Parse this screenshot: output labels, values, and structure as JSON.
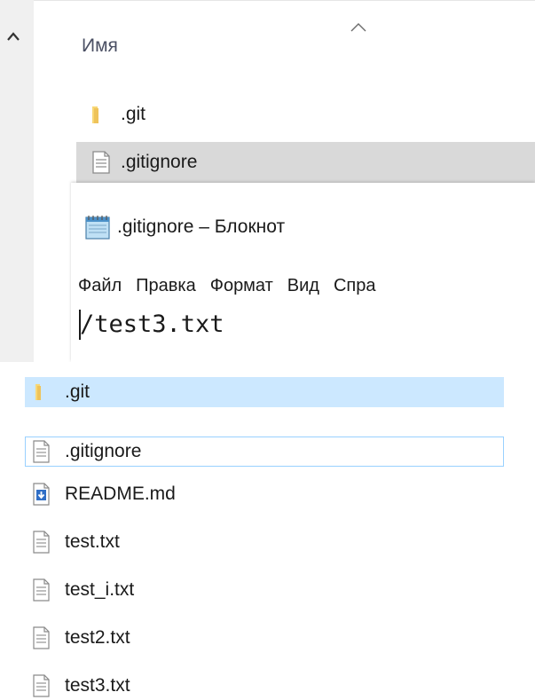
{
  "top_explorer": {
    "column_header": "Имя",
    "items": [
      {
        "name": ".git",
        "icon": "folder-icon"
      },
      {
        "name": ".gitignore",
        "icon": "text-file-icon",
        "selected": true
      }
    ]
  },
  "notepad": {
    "title": ".gitignore – Блокнот",
    "menu": [
      "Файл",
      "Правка",
      "Формат",
      "Вид",
      "Спра"
    ],
    "content": "/test3.txt"
  },
  "bottom_explorer": {
    "items": [
      {
        "name": ".git",
        "icon": "folder-icon"
      },
      {
        "name": ".gitignore",
        "icon": "text-file-icon"
      },
      {
        "name": "README.md",
        "icon": "download-file-icon"
      },
      {
        "name": "test.txt",
        "icon": "text-file-icon"
      },
      {
        "name": "test_i.txt",
        "icon": "text-file-icon"
      },
      {
        "name": "test2.txt",
        "icon": "text-file-icon"
      },
      {
        "name": "test3.txt",
        "icon": "text-file-icon"
      }
    ]
  },
  "colors": {
    "hover_row": "#cce8ff",
    "focus_border": "#99d1ff",
    "selected_row": "#d9d9d9",
    "nav_pane": "#f0f0f0",
    "folder": "#f8d775"
  }
}
